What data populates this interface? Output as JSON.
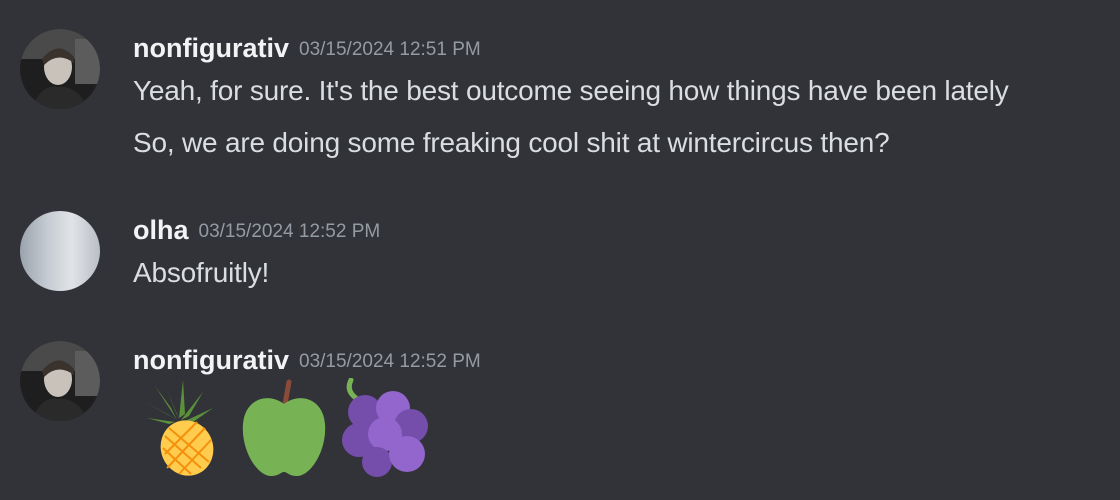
{
  "messages": [
    {
      "username": "nonfigurativ",
      "timestamp": "03/15/2024 12:51 PM",
      "lines": [
        "Yeah, for sure. It's the best outcome seeing how things have been lately",
        "So, we are doing some freaking cool shit at wintercircus then?"
      ]
    },
    {
      "username": "olha",
      "timestamp": "03/15/2024 12:52 PM",
      "lines": [
        "Absofruitly!"
      ]
    },
    {
      "username": "nonfigurativ",
      "timestamp": "03/15/2024 12:52 PM",
      "emojis": [
        "pineapple-icon",
        "green-apple-icon",
        "grapes-icon"
      ]
    }
  ],
  "colors": {
    "background": "#313338",
    "username": "#f2f3f5",
    "timestamp": "#949ba4",
    "text": "#dbdee1"
  }
}
